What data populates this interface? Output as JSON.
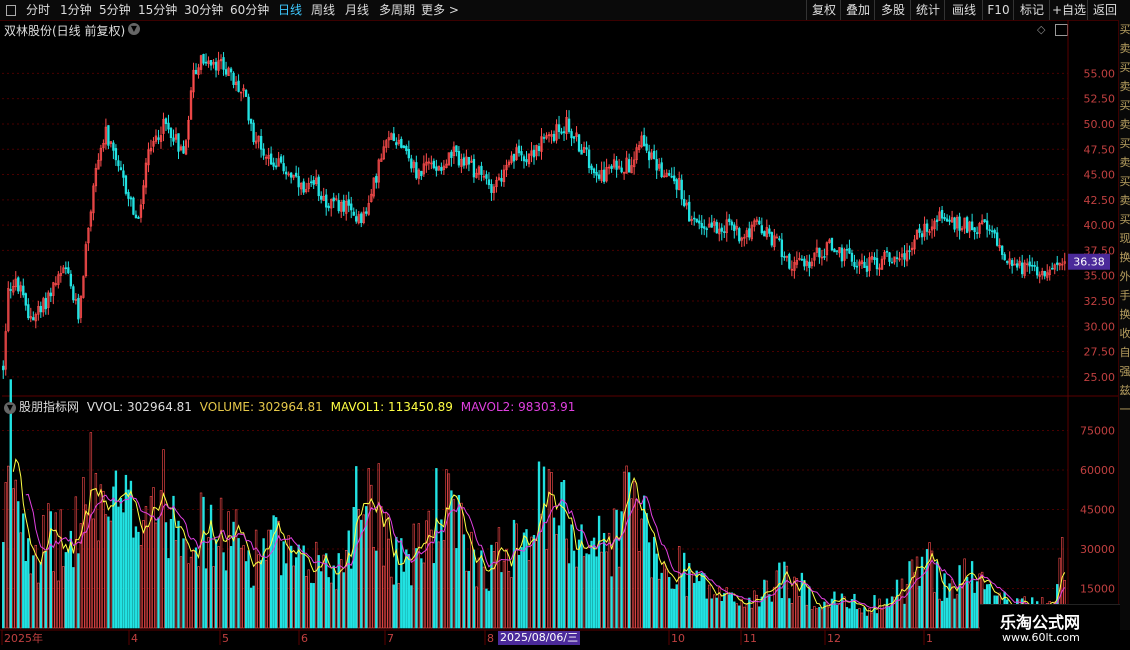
{
  "toolbar": {
    "left_items": [
      "分时",
      "1分钟",
      "5分钟",
      "15分钟",
      "30分钟",
      "60分钟",
      "日线",
      "周线",
      "月线",
      "多周期",
      "更多 >"
    ],
    "active_item": "日线",
    "right_items": [
      "复权",
      "叠加",
      "多股",
      "统计",
      "画线",
      "F10",
      "标记",
      "+自选",
      "返回"
    ]
  },
  "stock_title": "双林股份(日线 前复权)",
  "indicator": {
    "title": "股朋指标网",
    "vvol": "VVOL: 302964.81",
    "volume": "VOLUME: 302964.81",
    "mavol1": "MAVOL1: 113450.89",
    "mavol2": "MAVOL2: 98303.91"
  },
  "side_strip": "买卖买卖买卖买卖买卖买现换外手换收自强兹一",
  "watermark": {
    "line1": "乐淘公式网",
    "line2": "www.60lt.com"
  },
  "date_badge": "2025/08/06/三",
  "colors": {
    "up": "#ff4d4d",
    "down": "#22e3e3",
    "ma1": "#ffff44",
    "ma2": "#e040e0",
    "price_tag": "#4b2a9a"
  },
  "chart_data": {
    "type": "candlestick",
    "price_axis": {
      "ticks": [
        25,
        27.5,
        30,
        32.5,
        35,
        37.5,
        40,
        42.5,
        45,
        47.5,
        50,
        52.5,
        55
      ],
      "range": [
        23.5,
        58.5
      ]
    },
    "current_price_label": "36.38",
    "volume_axis": {
      "ticks": [
        15000,
        30000,
        45000,
        60000,
        75000
      ],
      "range": [
        0,
        82000
      ]
    },
    "x_axis_labels": [
      "2025年",
      "4",
      "5",
      "6",
      "7",
      "8",
      "9",
      "10",
      "11",
      "12",
      "1"
    ],
    "price_anchors": [
      [
        0,
        26
      ],
      [
        2,
        34
      ],
      [
        6,
        34
      ],
      [
        10,
        31
      ],
      [
        15,
        31.5
      ],
      [
        20,
        34
      ],
      [
        25,
        35.5
      ],
      [
        30,
        31
      ],
      [
        34,
        40
      ],
      [
        38,
        47
      ],
      [
        41,
        49
      ],
      [
        45,
        46
      ],
      [
        50,
        43
      ],
      [
        54,
        40
      ],
      [
        57,
        46
      ],
      [
        60,
        48
      ],
      [
        64,
        50
      ],
      [
        68,
        49
      ],
      [
        72,
        47
      ],
      [
        76,
        55
      ],
      [
        80,
        56.5
      ],
      [
        84,
        55.5
      ],
      [
        88,
        56
      ],
      [
        92,
        54
      ],
      [
        96,
        53
      ],
      [
        100,
        49
      ],
      [
        105,
        47
      ],
      [
        110,
        46
      ],
      [
        115,
        45
      ],
      [
        120,
        43
      ],
      [
        125,
        44
      ],
      [
        130,
        42
      ],
      [
        135,
        42
      ],
      [
        140,
        41
      ],
      [
        145,
        41
      ],
      [
        150,
        46
      ],
      [
        155,
        49
      ],
      [
        160,
        48
      ],
      [
        165,
        45
      ],
      [
        170,
        46
      ],
      [
        175,
        46
      ],
      [
        180,
        47
      ],
      [
        185,
        46
      ],
      [
        190,
        45
      ],
      [
        195,
        44
      ],
      [
        200,
        45
      ],
      [
        205,
        47
      ],
      [
        210,
        47
      ],
      [
        215,
        48
      ],
      [
        220,
        49
      ],
      [
        225,
        50
      ],
      [
        230,
        48
      ],
      [
        235,
        46
      ],
      [
        240,
        45
      ],
      [
        245,
        46
      ],
      [
        250,
        46
      ],
      [
        255,
        49
      ],
      [
        260,
        46
      ],
      [
        265,
        45
      ],
      [
        270,
        44
      ],
      [
        275,
        40
      ],
      [
        280,
        40
      ],
      [
        285,
        40
      ],
      [
        290,
        40
      ],
      [
        295,
        39
      ],
      [
        300,
        40
      ],
      [
        305,
        39
      ],
      [
        310,
        38
      ],
      [
        315,
        36
      ],
      [
        320,
        36
      ],
      [
        325,
        37
      ],
      [
        330,
        38
      ],
      [
        335,
        37
      ],
      [
        340,
        36.5
      ],
      [
        345,
        36
      ],
      [
        350,
        36.5
      ],
      [
        355,
        37
      ],
      [
        360,
        37
      ],
      [
        365,
        39
      ],
      [
        370,
        40
      ],
      [
        375,
        41
      ],
      [
        380,
        40
      ],
      [
        385,
        40
      ],
      [
        390,
        40
      ],
      [
        395,
        39
      ],
      [
        400,
        37
      ],
      [
        405,
        36
      ],
      [
        410,
        35.5
      ],
      [
        415,
        35.8
      ],
      [
        420,
        35.5
      ],
      [
        424,
        36.38
      ]
    ],
    "volume_anchors": [
      [
        0,
        28000
      ],
      [
        3,
        72000
      ],
      [
        8,
        42000
      ],
      [
        14,
        30000
      ],
      [
        20,
        34000
      ],
      [
        26,
        28000
      ],
      [
        30,
        42000
      ],
      [
        35,
        52000
      ],
      [
        40,
        48000
      ],
      [
        45,
        44000
      ],
      [
        50,
        42000
      ],
      [
        55,
        48000
      ],
      [
        60,
        52000
      ],
      [
        65,
        46000
      ],
      [
        70,
        44000
      ],
      [
        75,
        40000
      ],
      [
        80,
        36000
      ],
      [
        85,
        34000
      ],
      [
        90,
        36000
      ],
      [
        95,
        30000
      ],
      [
        100,
        26000
      ],
      [
        105,
        34000
      ],
      [
        110,
        30000
      ],
      [
        115,
        24000
      ],
      [
        120,
        22000
      ],
      [
        125,
        26000
      ],
      [
        130,
        22000
      ],
      [
        135,
        24000
      ],
      [
        140,
        44000
      ],
      [
        145,
        58000
      ],
      [
        150,
        46000
      ],
      [
        155,
        30000
      ],
      [
        160,
        26000
      ],
      [
        165,
        28000
      ],
      [
        170,
        38000
      ],
      [
        175,
        48000
      ],
      [
        180,
        40000
      ],
      [
        185,
        30000
      ],
      [
        190,
        26000
      ],
      [
        195,
        24000
      ],
      [
        200,
        30000
      ],
      [
        205,
        38000
      ],
      [
        210,
        42000
      ],
      [
        215,
        46000
      ],
      [
        220,
        44000
      ],
      [
        225,
        40000
      ],
      [
        230,
        36000
      ],
      [
        235,
        34000
      ],
      [
        240,
        30000
      ],
      [
        245,
        36000
      ],
      [
        250,
        52000
      ],
      [
        255,
        42000
      ],
      [
        260,
        24000
      ],
      [
        265,
        20000
      ],
      [
        270,
        24000
      ],
      [
        275,
        20000
      ],
      [
        280,
        16000
      ],
      [
        285,
        12000
      ],
      [
        290,
        12000
      ],
      [
        295,
        10000
      ],
      [
        300,
        10000
      ],
      [
        305,
        14000
      ],
      [
        310,
        20000
      ],
      [
        315,
        16000
      ],
      [
        320,
        14000
      ],
      [
        325,
        11000
      ],
      [
        330,
        10000
      ],
      [
        335,
        10000
      ],
      [
        340,
        9000
      ],
      [
        345,
        8000
      ],
      [
        350,
        10000
      ],
      [
        355,
        11000
      ],
      [
        360,
        16000
      ],
      [
        365,
        22000
      ],
      [
        370,
        24000
      ],
      [
        375,
        18000
      ],
      [
        380,
        16000
      ],
      [
        385,
        20000
      ],
      [
        390,
        18000
      ],
      [
        395,
        12000
      ],
      [
        400,
        10000
      ],
      [
        405,
        9000
      ],
      [
        410,
        8000
      ],
      [
        415,
        8000
      ],
      [
        420,
        8000
      ],
      [
        424,
        30000
      ]
    ],
    "bar_count": 425
  }
}
